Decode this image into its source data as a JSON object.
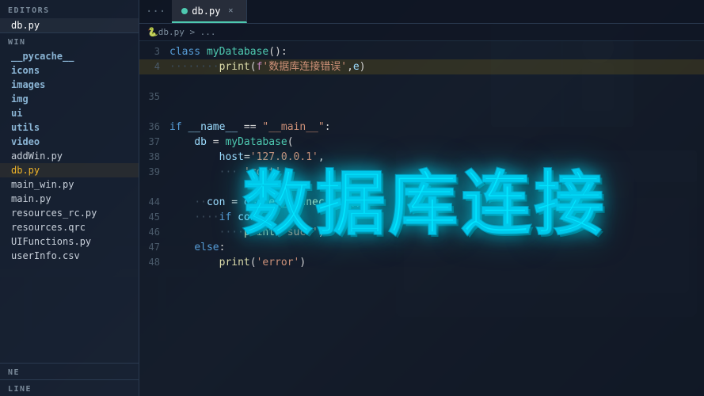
{
  "sidebar": {
    "editors_label": "EDITORS",
    "win_label": "WIN",
    "active_file": "db.py",
    "items": [
      {
        "name": "db.py",
        "type": "file",
        "active": true
      },
      {
        "name": "__pycache__",
        "type": "folder"
      },
      {
        "name": "icons",
        "type": "folder"
      },
      {
        "name": "images",
        "type": "folder"
      },
      {
        "name": "img",
        "type": "folder"
      },
      {
        "name": "ui",
        "type": "folder"
      },
      {
        "name": "utils",
        "type": "folder"
      },
      {
        "name": "video",
        "type": "folder"
      },
      {
        "name": "addWin.py",
        "type": "file"
      },
      {
        "name": "db.py",
        "type": "file",
        "highlight": true
      },
      {
        "name": "main_win.py",
        "type": "file"
      },
      {
        "name": "main.py",
        "type": "file"
      },
      {
        "name": "resources_rc.py",
        "type": "file"
      },
      {
        "name": "resources.qrc",
        "type": "file"
      },
      {
        "name": "UIFunctions.py",
        "type": "file"
      },
      {
        "name": "userInfo.csv",
        "type": "file"
      }
    ],
    "bottom_items": [
      {
        "name": "NE"
      },
      {
        "name": "LINE"
      }
    ]
  },
  "tabs": [
    {
      "label": "...",
      "active": false
    },
    {
      "label": "db.py",
      "active": true,
      "closable": true
    }
  ],
  "breadcrumb": "db.py > ...",
  "title_overlay": "数据库连接",
  "code": {
    "lines": [
      {
        "num": "3",
        "tokens": [
          {
            "t": "kw",
            "v": "class "
          },
          {
            "t": "cls",
            "v": "myDatabase"
          },
          {
            "t": "op",
            "v": "():"
          }
        ]
      },
      {
        "num": "4",
        "content": "        ········print(f'数据库连接错误',e)",
        "highlighted": true
      },
      {
        "num": "",
        "content": ""
      },
      {
        "num": "35",
        "content": ""
      },
      {
        "num": "",
        "content": ""
      },
      {
        "num": "36",
        "content": "if __name__ == \"__main__\":"
      },
      {
        "num": "37",
        "content": "    db = myDatabase("
      },
      {
        "num": "38",
        "content": "        host='127.0.0.1',"
      },
      {
        "num": "39",
        "content": "        ··· 'root'"
      },
      {
        "num": "",
        "content": ""
      },
      {
        "num": "44",
        "content": "    ··con = db.get_connection();"
      },
      {
        "num": "45",
        "content": "    ····if con:"
      },
      {
        "num": "46",
        "content": "        ····print('succ')"
      },
      {
        "num": "47",
        "content": "    else:"
      },
      {
        "num": "48",
        "content": "        print('error')"
      }
    ]
  },
  "status_bar": {
    "items": [
      "LINE",
      "NE"
    ]
  }
}
